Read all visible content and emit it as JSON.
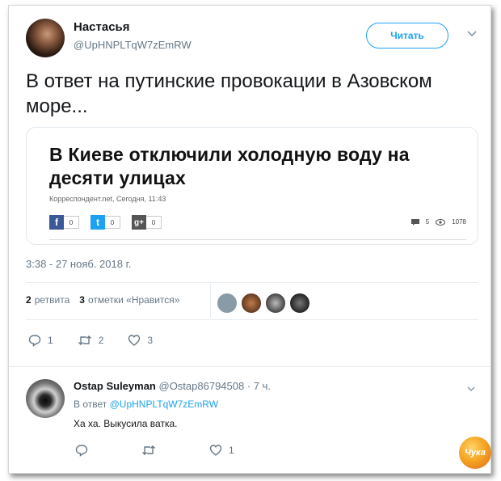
{
  "tweet": {
    "author_name": "Настасья",
    "author_handle": "@UpHNPLTqW7zEmRW",
    "follow_label": "Читать",
    "text": "В ответ на путинские провокации в Азовском море...",
    "timestamp": "3:38 - 27 нояб. 2018 г.",
    "retweet_count": "2",
    "retweet_label": "ретвита",
    "like_count": "3",
    "like_label": "отметки «Нравится»",
    "actions": {
      "replies": "1",
      "retweets": "2",
      "likes": "3"
    }
  },
  "embed": {
    "headline": "В Киеве отключили холодную воду на десяти улицах",
    "meta": "Корреспондент.net, Сегодня, 11:43",
    "shares": [
      {
        "icon": "facebook-icon",
        "glyph": "f",
        "count": "0",
        "color": "#3b5998"
      },
      {
        "icon": "twitter-icon",
        "glyph": "t",
        "count": "0",
        "color": "#1da1f2"
      },
      {
        "icon": "google-plus-icon",
        "glyph": "g+",
        "count": "0",
        "color": "#555555"
      }
    ],
    "comments": "5",
    "views": "1078"
  },
  "reply": {
    "author_name": "Ostap Suleyman",
    "author_handle": "@Ostap86794508",
    "time": "· 7 ч.",
    "in_reply_prefix": "В ответ",
    "in_reply_handle": "@UpHNPLTqW7zEmRW",
    "text": "Ха ха. Выкусила ватка.",
    "actions": {
      "replies": "",
      "retweets": "",
      "likes": "1"
    }
  },
  "watermark": "Чука",
  "colors": {
    "accent": "#1da1f2",
    "muted": "#657786",
    "text": "#14171a"
  }
}
